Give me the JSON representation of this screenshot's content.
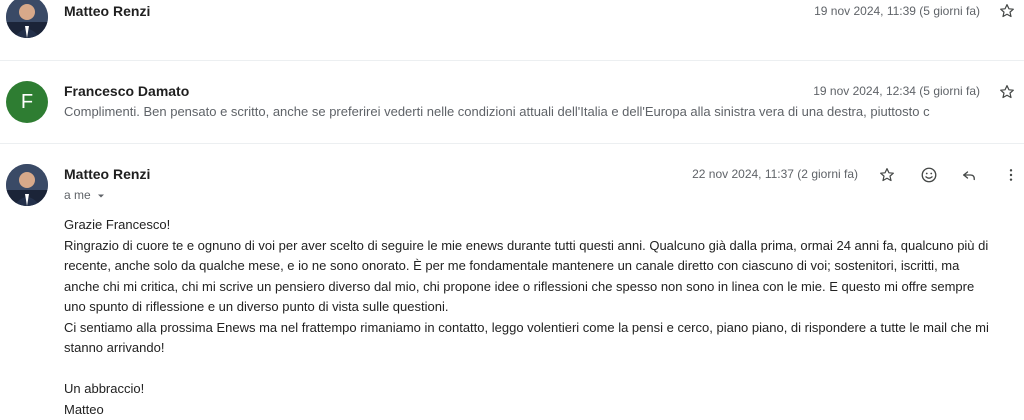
{
  "messages": [
    {
      "sender": "Matteo Renzi",
      "date": "19 nov 2024, 11:39 (5 giorni fa)"
    },
    {
      "sender": "Francesco Damato",
      "avatar_letter": "F",
      "date": "19 nov 2024, 12:34 (5 giorni fa)",
      "snippet": "Complimenti. Ben pensato e scritto, anche se preferirei vederti nelle condizioni attuali dell'Italia e dell'Europa alla sinistra vera di una destra, piuttosto c"
    },
    {
      "sender": "Matteo Renzi",
      "date": "22 nov 2024, 11:37 (2 giorni fa)",
      "to_label": "a me",
      "body": {
        "greeting": "Grazie Francesco!",
        "p1_l1": "Ringrazio di cuore te e ognuno di voi per aver scelto di seguire le mie enews durante tutti questi anni. Qualcuno già dalla prima, ormai 24 anni fa, qualcuno più di",
        "p1_l2": "recente, anche solo da qualche mese, e io ne sono onorato. È per me fondamentale mantenere un canale diretto con ciascuno di voi; sostenitori, iscritti, ma",
        "p1_l3": "anche chi mi critica, chi mi scrive un pensiero diverso dal mio, chi propone idee o riflessioni che spesso non sono in linea con le mie. E questo mi offre sempre",
        "p1_l4": "uno spunto di riflessione e un diverso punto di vista sulle questioni.",
        "p2_l1": "Ci sentiamo alla prossima Enews ma nel frattempo rimaniamo in contatto, leggo volentieri come la pensi e cerco, piano piano, di rispondere a tutte le mail che mi",
        "p2_l2": "stanno arrivando!",
        "closing": "Un abbraccio!",
        "signature": "Matteo"
      }
    }
  ],
  "icons": {
    "star": "star-icon",
    "emoji": "emoji-icon",
    "reply": "reply-icon",
    "more": "more-vert-icon",
    "chevron": "chevron-down-icon"
  },
  "colors": {
    "avatar_letter_bg": "#2e7d32",
    "secondary_text": "#5f6368"
  }
}
